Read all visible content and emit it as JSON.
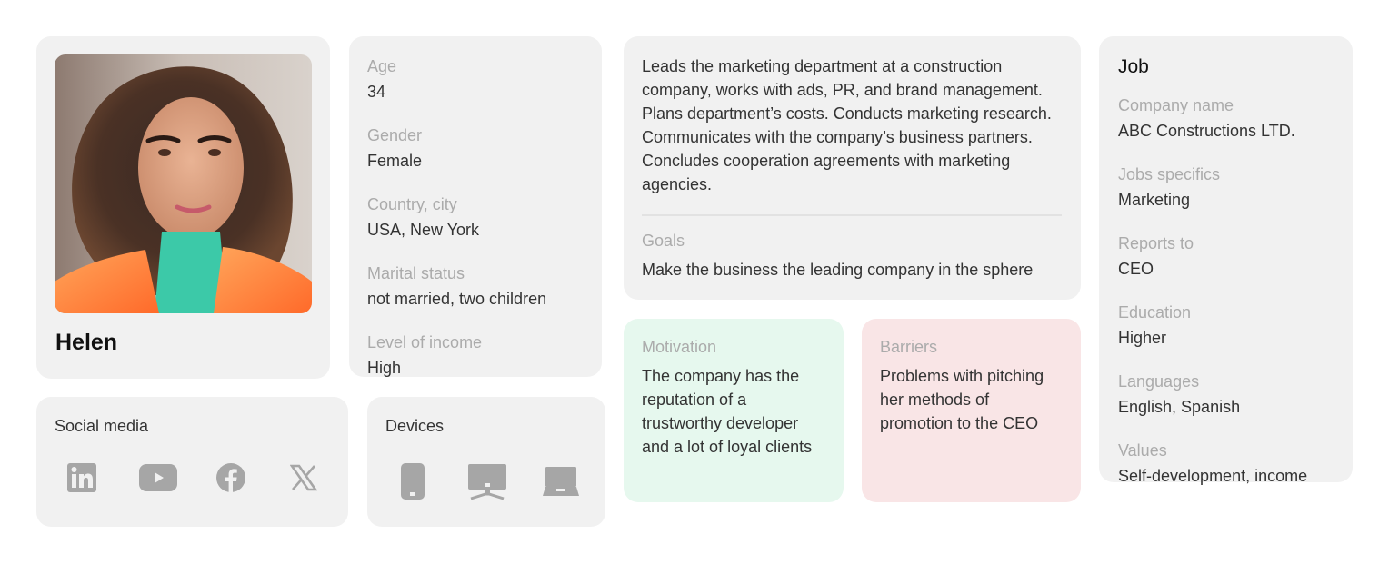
{
  "profile": {
    "name": "Helen",
    "photo_alt": "Portrait of Helen"
  },
  "demographics": {
    "fields": [
      {
        "label": "Age",
        "value": "34"
      },
      {
        "label": "Gender",
        "value": "Female"
      },
      {
        "label": "Country, city",
        "value": "USA, New York"
      },
      {
        "label": "Marital status",
        "value": "not married, two children"
      },
      {
        "label": "Level of income",
        "value": "High"
      }
    ]
  },
  "social": {
    "title": "Social media",
    "icons": [
      "linkedin-icon",
      "youtube-icon",
      "facebook-icon",
      "x-twitter-icon"
    ]
  },
  "devices": {
    "title": "Devices",
    "icons": [
      "smartphone-icon",
      "desktop-icon",
      "laptop-icon"
    ]
  },
  "description": {
    "text": "Leads the marketing department at a construction company, works with ads, PR, and brand management. Plans department’s costs. Conducts marketing research. Communicates with the company’s business partners. Concludes cooperation agreements with marketing agencies.",
    "goals_label": "Goals",
    "goals_value": "Make the business the leading company in the sphere"
  },
  "motivation": {
    "label": "Motivation",
    "text": "The company has the reputation of a trustworthy developer and a lot of loyal clients",
    "bg_color": "#e6f8ee"
  },
  "barriers": {
    "label": "Barriers",
    "text": "Problems with pitching her methods of promotion to the CEO",
    "bg_color": "#f9e5e6"
  },
  "job": {
    "title": "Job",
    "fields": [
      {
        "label": "Company name",
        "value": "ABC Constructions LTD."
      },
      {
        "label": "Jobs specifics",
        "value": "Marketing"
      },
      {
        "label": "Reports to",
        "value": "CEO"
      },
      {
        "label": "Education",
        "value": "Higher"
      },
      {
        "label": "Languages",
        "value": "English, Spanish"
      },
      {
        "label": "Values",
        "value": "Self-development, income"
      }
    ]
  },
  "colors": {
    "card_bg": "#f1f1f1",
    "label": "#ababab",
    "text": "#333333",
    "icon": "#a6a6a6"
  }
}
